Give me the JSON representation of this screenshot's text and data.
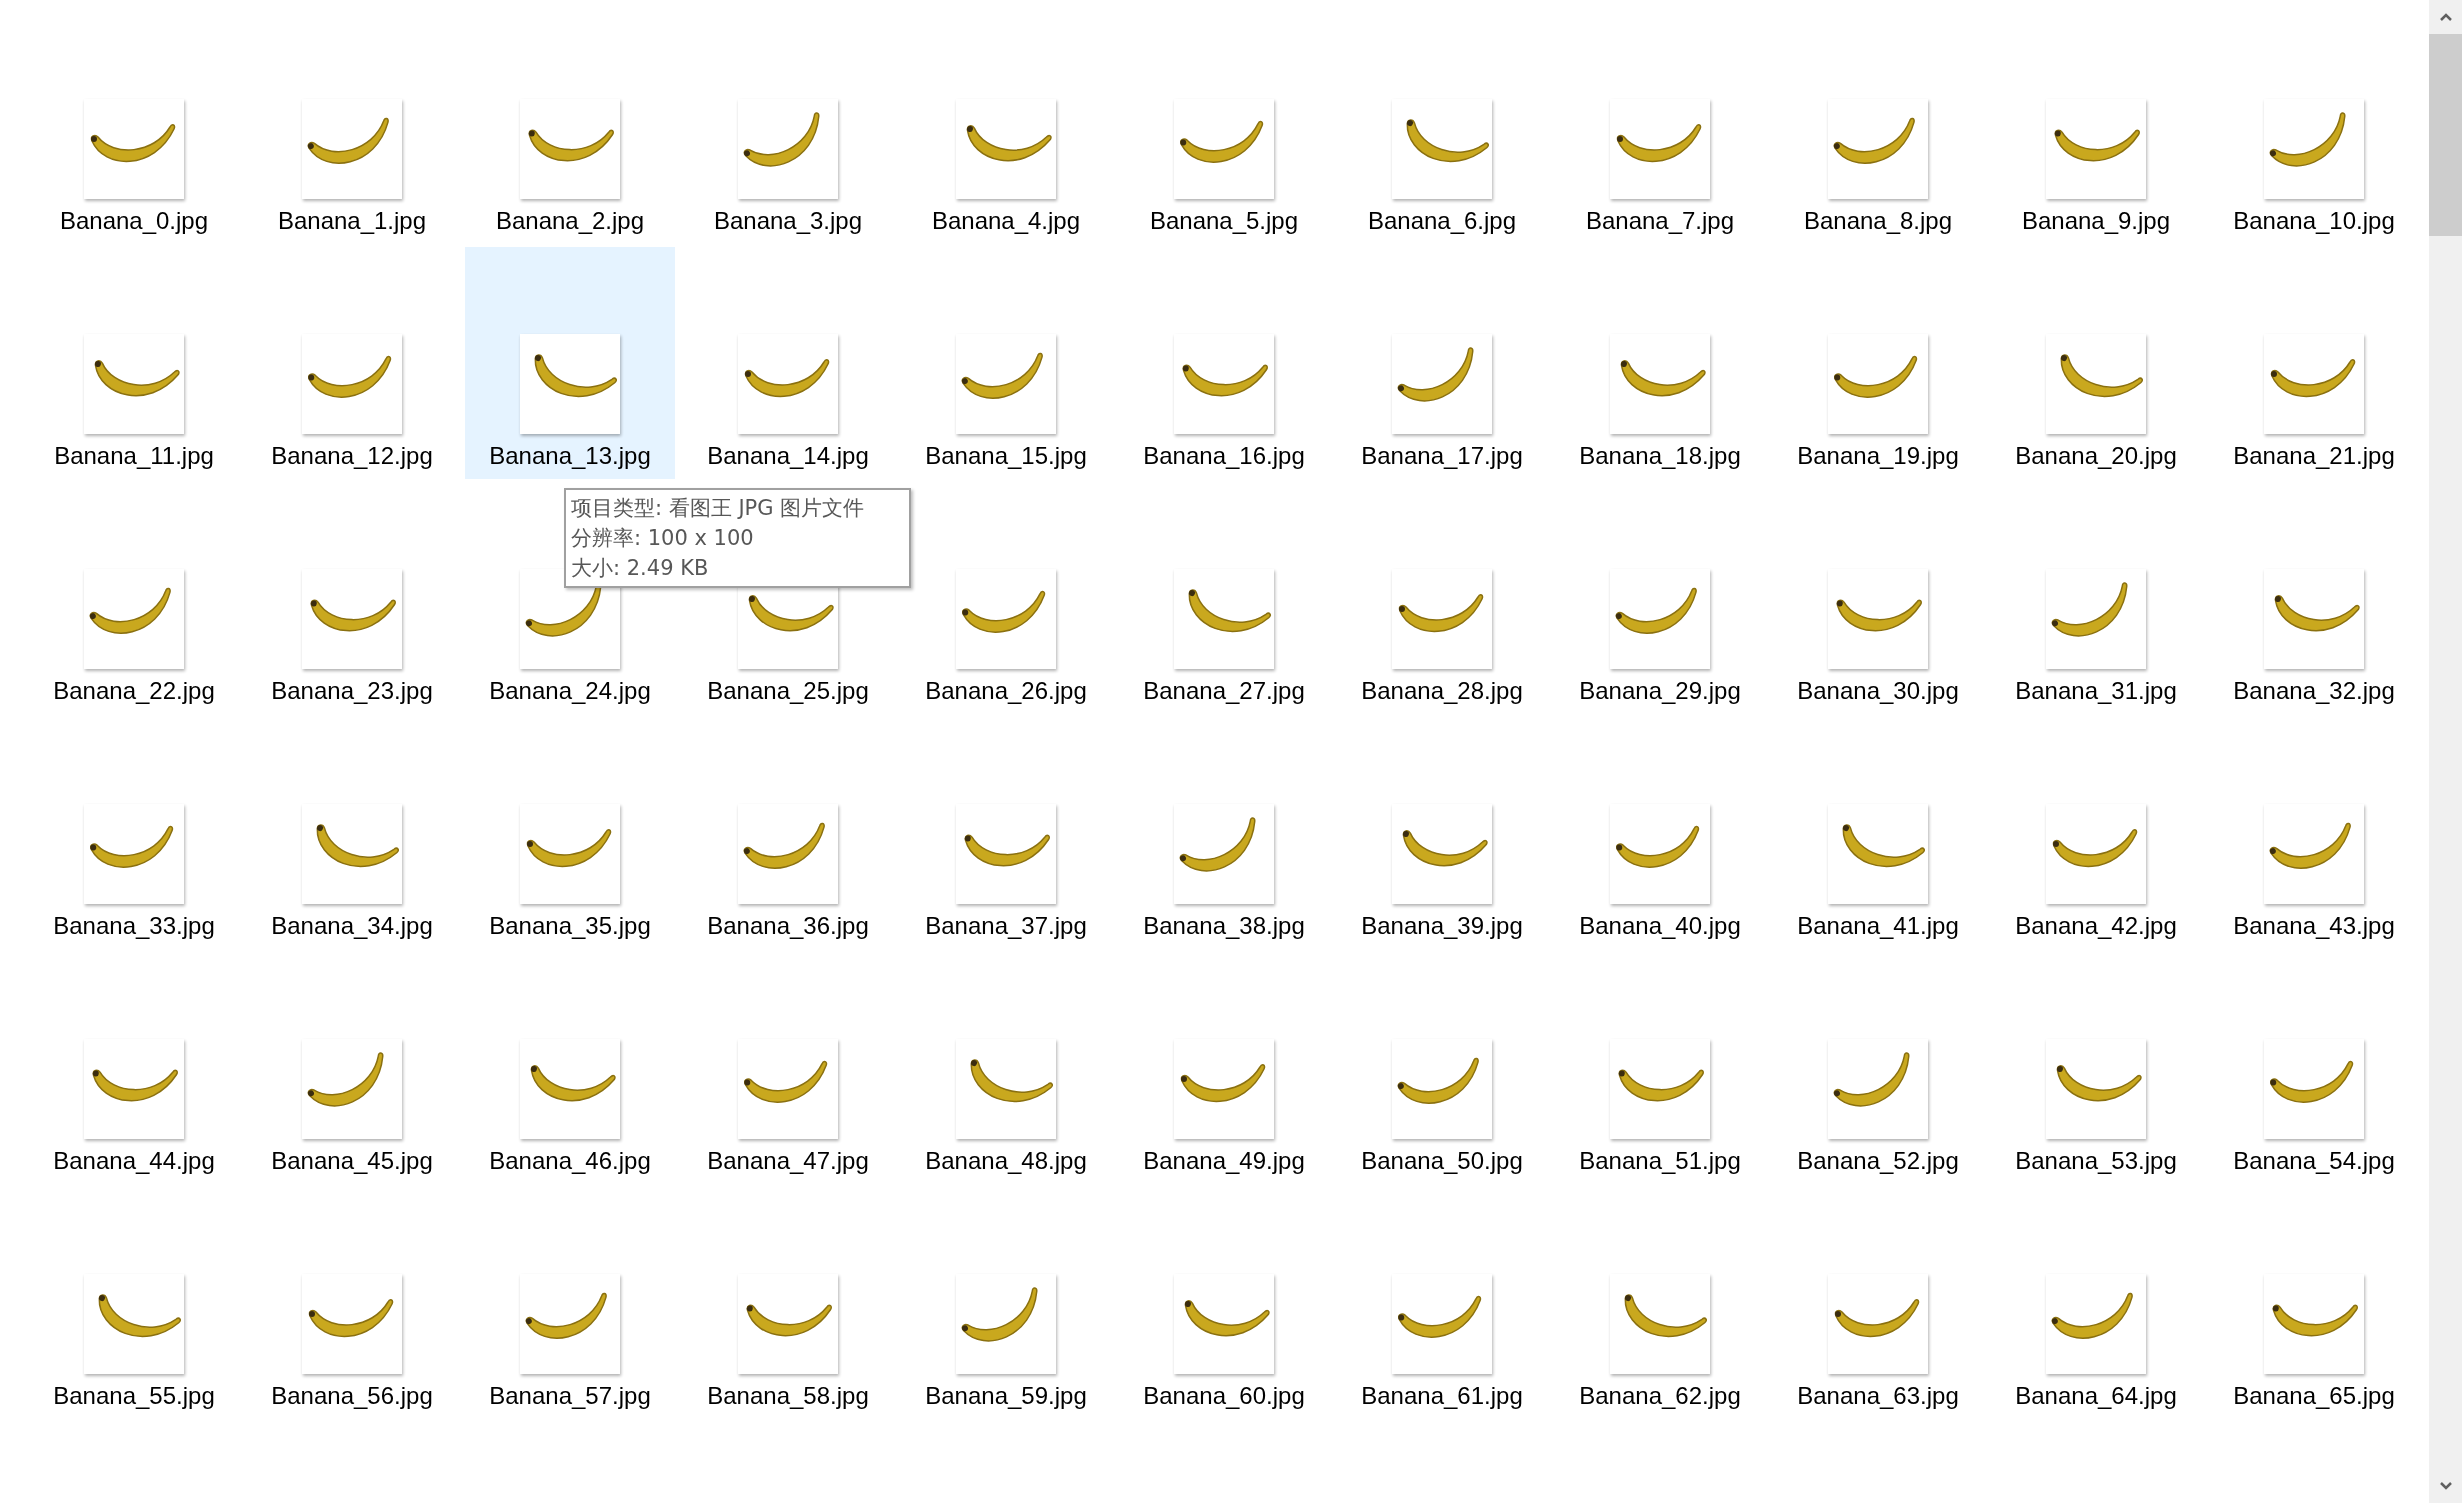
{
  "files": [
    {
      "name": "Banana_0.jpg",
      "selected": false
    },
    {
      "name": "Banana_1.jpg",
      "selected": false
    },
    {
      "name": "Banana_2.jpg",
      "selected": false
    },
    {
      "name": "Banana_3.jpg",
      "selected": false
    },
    {
      "name": "Banana_4.jpg",
      "selected": false
    },
    {
      "name": "Banana_5.jpg",
      "selected": false
    },
    {
      "name": "Banana_6.jpg",
      "selected": false
    },
    {
      "name": "Banana_7.jpg",
      "selected": false
    },
    {
      "name": "Banana_8.jpg",
      "selected": false
    },
    {
      "name": "Banana_9.jpg",
      "selected": false
    },
    {
      "name": "Banana_10.jpg",
      "selected": false
    },
    {
      "name": "Banana_11.jpg",
      "selected": false
    },
    {
      "name": "Banana_12.jpg",
      "selected": false
    },
    {
      "name": "Banana_13.jpg",
      "selected": true
    },
    {
      "name": "Banana_14.jpg",
      "selected": false
    },
    {
      "name": "Banana_15.jpg",
      "selected": false
    },
    {
      "name": "Banana_16.jpg",
      "selected": false
    },
    {
      "name": "Banana_17.jpg",
      "selected": false
    },
    {
      "name": "Banana_18.jpg",
      "selected": false
    },
    {
      "name": "Banana_19.jpg",
      "selected": false
    },
    {
      "name": "Banana_20.jpg",
      "selected": false
    },
    {
      "name": "Banana_21.jpg",
      "selected": false
    },
    {
      "name": "Banana_22.jpg",
      "selected": false
    },
    {
      "name": "Banana_23.jpg",
      "selected": false
    },
    {
      "name": "Banana_24.jpg",
      "selected": false
    },
    {
      "name": "Banana_25.jpg",
      "selected": false
    },
    {
      "name": "Banana_26.jpg",
      "selected": false
    },
    {
      "name": "Banana_27.jpg",
      "selected": false
    },
    {
      "name": "Banana_28.jpg",
      "selected": false
    },
    {
      "name": "Banana_29.jpg",
      "selected": false
    },
    {
      "name": "Banana_30.jpg",
      "selected": false
    },
    {
      "name": "Banana_31.jpg",
      "selected": false
    },
    {
      "name": "Banana_32.jpg",
      "selected": false
    },
    {
      "name": "Banana_33.jpg",
      "selected": false
    },
    {
      "name": "Banana_34.jpg",
      "selected": false
    },
    {
      "name": "Banana_35.jpg",
      "selected": false
    },
    {
      "name": "Banana_36.jpg",
      "selected": false
    },
    {
      "name": "Banana_37.jpg",
      "selected": false
    },
    {
      "name": "Banana_38.jpg",
      "selected": false
    },
    {
      "name": "Banana_39.jpg",
      "selected": false
    },
    {
      "name": "Banana_40.jpg",
      "selected": false
    },
    {
      "name": "Banana_41.jpg",
      "selected": false
    },
    {
      "name": "Banana_42.jpg",
      "selected": false
    },
    {
      "name": "Banana_43.jpg",
      "selected": false
    },
    {
      "name": "Banana_44.jpg",
      "selected": false
    },
    {
      "name": "Banana_45.jpg",
      "selected": false
    },
    {
      "name": "Banana_46.jpg",
      "selected": false
    },
    {
      "name": "Banana_47.jpg",
      "selected": false
    },
    {
      "name": "Banana_48.jpg",
      "selected": false
    },
    {
      "name": "Banana_49.jpg",
      "selected": false
    },
    {
      "name": "Banana_50.jpg",
      "selected": false
    },
    {
      "name": "Banana_51.jpg",
      "selected": false
    },
    {
      "name": "Banana_52.jpg",
      "selected": false
    },
    {
      "name": "Banana_53.jpg",
      "selected": false
    },
    {
      "name": "Banana_54.jpg",
      "selected": false
    },
    {
      "name": "Banana_55.jpg",
      "selected": false
    },
    {
      "name": "Banana_56.jpg",
      "selected": false
    },
    {
      "name": "Banana_57.jpg",
      "selected": false
    },
    {
      "name": "Banana_58.jpg",
      "selected": false
    },
    {
      "name": "Banana_59.jpg",
      "selected": false
    },
    {
      "name": "Banana_60.jpg",
      "selected": false
    },
    {
      "name": "Banana_61.jpg",
      "selected": false
    },
    {
      "name": "Banana_62.jpg",
      "selected": false
    },
    {
      "name": "Banana_63.jpg",
      "selected": false
    },
    {
      "name": "Banana_64.jpg",
      "selected": false
    },
    {
      "name": "Banana_65.jpg",
      "selected": false
    }
  ],
  "tooltip": {
    "lines": [
      "项目类型: 看图王 JPG 图片文件",
      "分辨率: 100 x 100",
      "大小: 2.49 KB"
    ]
  }
}
